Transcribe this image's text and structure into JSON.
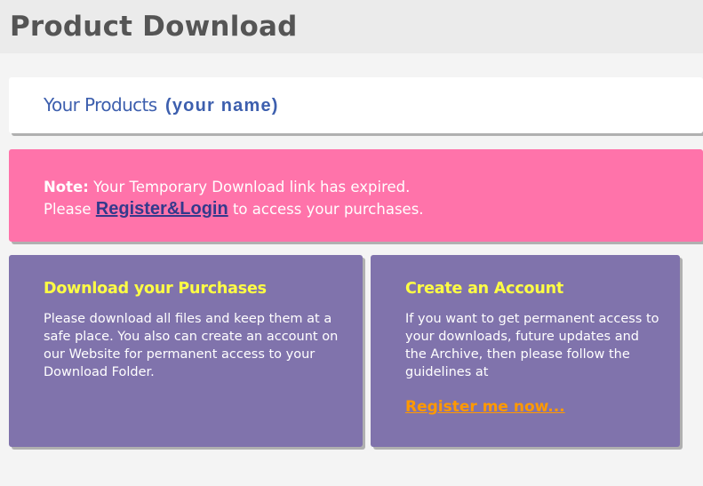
{
  "header": {
    "title": "Product Download"
  },
  "products": {
    "label": "Your Products",
    "user": "(your name)"
  },
  "note": {
    "prefix": "Note:",
    "message": "Your Temporary Download link has expired.",
    "line2_before": "Please",
    "link_label": "Register&Login",
    "line2_after": "to access your purchases."
  },
  "download_card": {
    "title": "Download your Purchases",
    "text": "Please download all files and keep them at a safe place. You also can create an account on our Website for permanent access to your Download Folder."
  },
  "account_card": {
    "title": "Create an Account",
    "text": "If you want to get permanent access to your downloads, future updates and the Archive, then please follow the guidelines at",
    "link_label": "Register me now..."
  },
  "colors": {
    "note_background": "#ff73aa",
    "card_background": "#8073ac",
    "card_title": "#ffff44",
    "register_link": "#ff9900",
    "products_heading": "#3d5fae"
  }
}
